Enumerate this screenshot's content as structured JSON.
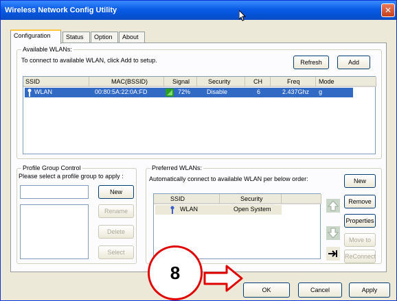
{
  "window": {
    "title": "Wireless Network Config Utility",
    "close_glyph": "✕"
  },
  "tabs": [
    {
      "label": "Configuration"
    },
    {
      "label": "Status"
    },
    {
      "label": "Option"
    },
    {
      "label": "About"
    }
  ],
  "available": {
    "legend": "Available WLANs:",
    "instruction": "To connect to available WLAN, click Add to setup.",
    "refresh_label": "Refresh",
    "add_label": "Add",
    "columns": [
      "SSID",
      "MAC(BSSID)",
      "Signal",
      "Security",
      "CH",
      "Freq",
      "Mode"
    ],
    "rows": [
      {
        "ssid": "WLAN",
        "mac": "00:80:5A:22:0A:FD",
        "signal": "72%",
        "security": "Disable",
        "ch": "6",
        "freq": "2.437Ghz",
        "mode": "g",
        "selected": true
      }
    ]
  },
  "profile_group": {
    "legend": "Profile Group Control",
    "instruction": "Please select a profile group to apply :",
    "new_label": "New",
    "rename_label": "Rename",
    "delete_label": "Delete",
    "select_label": "Select"
  },
  "preferred": {
    "legend": "Preferred WLANs:",
    "instruction": "Automatically connect to available WLAN per below order:",
    "columns": [
      "SSID",
      "Security"
    ],
    "rows": [
      {
        "ssid": "WLAN",
        "security": "Open System"
      }
    ],
    "new_label": "New",
    "remove_label": "Remove",
    "properties_label": "Properties",
    "moveto_label": "Move to",
    "reconnect_label": "ReConnect"
  },
  "footer": {
    "ok_label": "OK",
    "cancel_label": "Cancel",
    "apply_label": "Apply"
  },
  "annotation": {
    "step_number": "8",
    "color": "#e00000"
  }
}
